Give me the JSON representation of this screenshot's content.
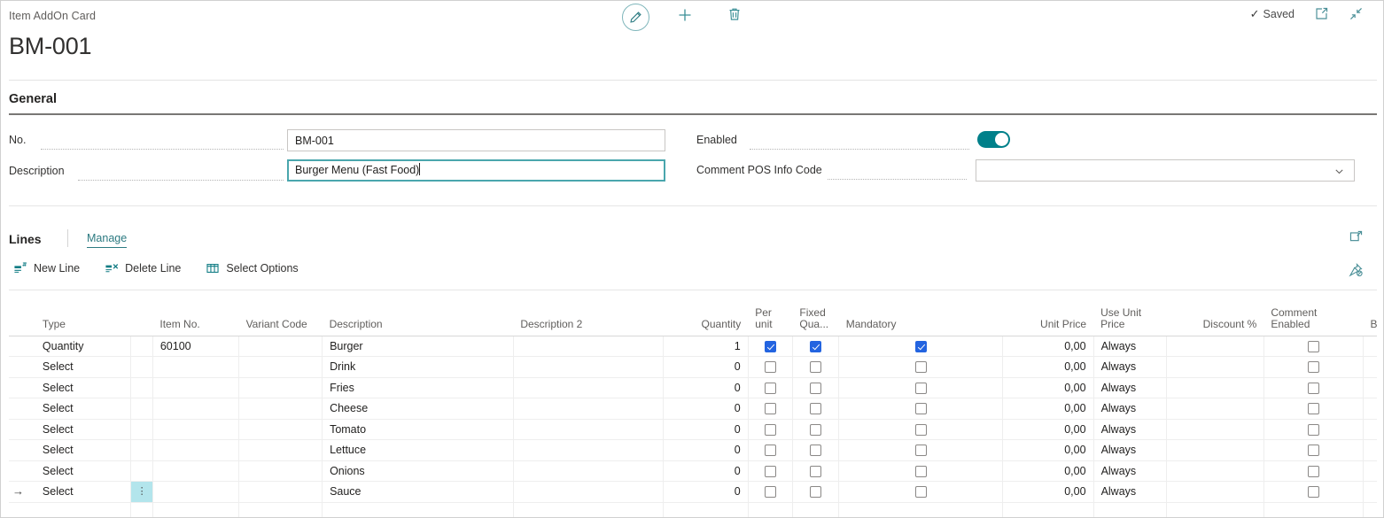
{
  "window": {
    "breadcrumb": "Item AddOn Card",
    "title": "BM-001"
  },
  "top_actions": [
    {
      "name": "edit-pencil-icon",
      "label": "Edit"
    },
    {
      "name": "add-icon",
      "label": "New"
    },
    {
      "name": "delete-icon",
      "label": "Delete"
    }
  ],
  "top_right": {
    "saved_label": "Saved",
    "saved_check": "✓",
    "open_new_window_icon": "open-in-new-window-icon",
    "collapse_icon": "collapse-icon"
  },
  "general": {
    "heading": "General",
    "no_label": "No.",
    "no_value": "BM-001",
    "description_label": "Description",
    "description_value": "Burger Menu (Fast Food)",
    "enabled_label": "Enabled",
    "enabled_value": true,
    "comment_pos_label": "Comment POS Info Code",
    "comment_pos_value": "",
    "dropdown_chevron": "⌄"
  },
  "lines": {
    "title": "Lines",
    "manage_tab": "Manage",
    "toolbar": [
      {
        "name": "new-line-button",
        "label": "New Line",
        "icon": "new-line-icon"
      },
      {
        "name": "delete-line-button",
        "label": "Delete Line",
        "icon": "delete-line-icon"
      },
      {
        "name": "select-options-button",
        "label": "Select Options",
        "icon": "select-options-icon"
      }
    ],
    "right_icons": [
      {
        "name": "open-in-excel-icon"
      },
      {
        "name": "unpin-icon"
      }
    ],
    "columns": [
      {
        "key": "type",
        "label": "Type",
        "align": "left"
      },
      {
        "key": "item_no",
        "label": "Item No.",
        "align": "left"
      },
      {
        "key": "variant_code",
        "label": "Variant Code",
        "align": "left"
      },
      {
        "key": "description",
        "label": "Description",
        "align": "left"
      },
      {
        "key": "description2",
        "label": "Description 2",
        "align": "left"
      },
      {
        "key": "quantity",
        "label": "Quantity",
        "align": "right"
      },
      {
        "key": "per_unit",
        "label": "Per unit",
        "align": "left"
      },
      {
        "key": "fixed_qua",
        "label": "Fixed Qua...",
        "align": "left"
      },
      {
        "key": "mandatory",
        "label": "Mandatory",
        "align": "left"
      },
      {
        "key": "unit_price",
        "label": "Unit Price",
        "align": "right"
      },
      {
        "key": "use_unit_price",
        "label": "Use Unit Price",
        "align": "left"
      },
      {
        "key": "discount_pct",
        "label": "Discount %",
        "align": "right"
      },
      {
        "key": "comment_enabled",
        "label": "Comment Enabled",
        "align": "left"
      },
      {
        "key": "before_insert",
        "label": "Before Insert Func",
        "align": "left"
      }
    ],
    "rows": [
      {
        "selected": false,
        "type": "Quantity",
        "item_no": "60100",
        "variant_code": "",
        "description": "Burger",
        "description2": "",
        "quantity": "1",
        "per_unit": true,
        "fixed_qua": true,
        "mandatory": true,
        "unit_price": "0,00",
        "use_unit_price": "Always",
        "discount_pct": "",
        "comment_enabled": false,
        "before_insert": ""
      },
      {
        "selected": false,
        "type": "Select",
        "item_no": "",
        "variant_code": "",
        "description": "Drink",
        "description2": "",
        "quantity": "0",
        "per_unit": false,
        "fixed_qua": false,
        "mandatory": false,
        "unit_price": "0,00",
        "use_unit_price": "Always",
        "discount_pct": "",
        "comment_enabled": false,
        "before_insert": ""
      },
      {
        "selected": false,
        "type": "Select",
        "item_no": "",
        "variant_code": "",
        "description": "Fries",
        "description2": "",
        "quantity": "0",
        "per_unit": false,
        "fixed_qua": false,
        "mandatory": false,
        "unit_price": "0,00",
        "use_unit_price": "Always",
        "discount_pct": "",
        "comment_enabled": false,
        "before_insert": ""
      },
      {
        "selected": false,
        "type": "Select",
        "item_no": "",
        "variant_code": "",
        "description": "Cheese",
        "description2": "",
        "quantity": "0",
        "per_unit": false,
        "fixed_qua": false,
        "mandatory": false,
        "unit_price": "0,00",
        "use_unit_price": "Always",
        "discount_pct": "",
        "comment_enabled": false,
        "before_insert": ""
      },
      {
        "selected": false,
        "type": "Select",
        "item_no": "",
        "variant_code": "",
        "description": "Tomato",
        "description2": "",
        "quantity": "0",
        "per_unit": false,
        "fixed_qua": false,
        "mandatory": false,
        "unit_price": "0,00",
        "use_unit_price": "Always",
        "discount_pct": "",
        "comment_enabled": false,
        "before_insert": ""
      },
      {
        "selected": false,
        "type": "Select",
        "item_no": "",
        "variant_code": "",
        "description": "Lettuce",
        "description2": "",
        "quantity": "0",
        "per_unit": false,
        "fixed_qua": false,
        "mandatory": false,
        "unit_price": "0,00",
        "use_unit_price": "Always",
        "discount_pct": "",
        "comment_enabled": false,
        "before_insert": ""
      },
      {
        "selected": false,
        "type": "Select",
        "item_no": "",
        "variant_code": "",
        "description": "Onions",
        "description2": "",
        "quantity": "0",
        "per_unit": false,
        "fixed_qua": false,
        "mandatory": false,
        "unit_price": "0,00",
        "use_unit_price": "Always",
        "discount_pct": "",
        "comment_enabled": false,
        "before_insert": ""
      },
      {
        "selected": true,
        "type": "Select",
        "item_no": "",
        "variant_code": "",
        "description": "Sauce",
        "description2": "",
        "quantity": "0",
        "per_unit": false,
        "fixed_qua": false,
        "mandatory": false,
        "unit_price": "0,00",
        "use_unit_price": "Always",
        "discount_pct": "",
        "comment_enabled": false,
        "before_insert": ""
      }
    ],
    "row_arrow": "→",
    "row_menu_glyph": "⋮"
  },
  "colors": {
    "accent_teal": "#2c7a81",
    "toggle_on": "#00808a",
    "checkbox_on": "#2364e0",
    "cell_highlight": "#b3e5ec"
  }
}
